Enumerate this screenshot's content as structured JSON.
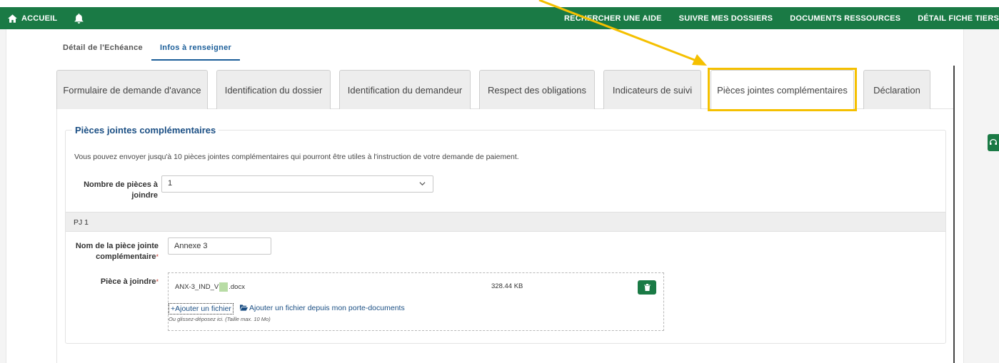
{
  "nav": {
    "home_label": "ACCUEIL",
    "right_items": [
      "RECHERCHER UNE AIDE",
      "SUIVRE MES DOSSIERS",
      "DOCUMENTS RESSOURCES",
      "DÉTAIL FICHE TIERS"
    ]
  },
  "upper_tabs": [
    "Détail de l'Echéance",
    "Infos à renseigner"
  ],
  "main_tabs": [
    "Formulaire de demande d'avance",
    "Identification du dossier",
    "Identification du demandeur",
    "Respect des obligations",
    "Indicateurs de suivi",
    "Pièces jointes complémentaires",
    "Déclaration"
  ],
  "section": {
    "title": "Pièces jointes complémentaires",
    "intro": "Vous pouvez envoyer jusqu'à 10 pièces jointes complémentaires qui pourront être utiles à l'instruction de votre demande de paiement.",
    "count_label_1": "Nombre de pièces à",
    "count_label_2": "joindre",
    "count_value": "1"
  },
  "pj": {
    "header": "PJ 1",
    "name_label_1": "Nom de la pièce jointe",
    "name_label_2": "complémentaire",
    "name_value": "Annexe 3",
    "file_label": "Pièce à joindre",
    "required_mark": "*",
    "file_name_prefix": "ANX-3_IND_V",
    "file_name_suffix": ".docx",
    "file_size": "328.44 KB",
    "add_file": "+Ajouter un fichier",
    "add_from_portfolio": "Ajouter un fichier depuis mon porte-documents",
    "hint": "Ou glissez-déposez ici. (Taille max. 10 Mo)"
  },
  "colors": {
    "nav_green": "#1a7a45",
    "link_blue": "#1b4f84",
    "highlight_yellow": "#f5c000"
  }
}
